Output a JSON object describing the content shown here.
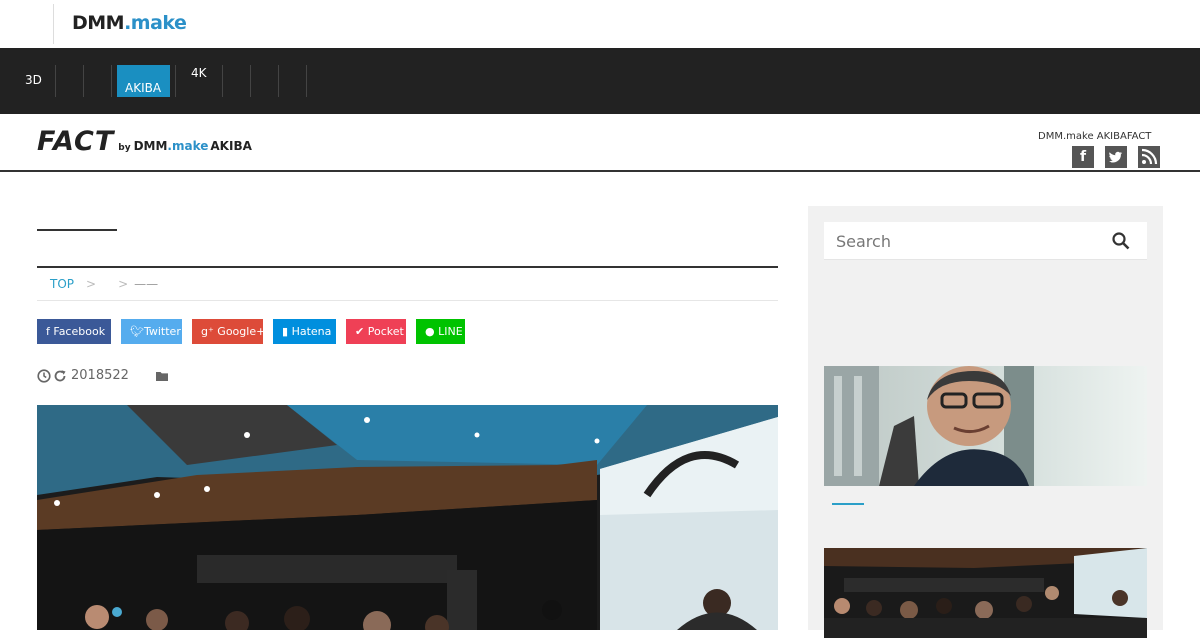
{
  "topbar": {
    "logo_dmm": "DMM",
    "logo_make": ".make"
  },
  "nav": {
    "items": [
      {
        "label": "3D"
      },
      {
        "label": "AKIBA",
        "active": true
      },
      {
        "label": "4K"
      }
    ]
  },
  "fact_header": {
    "logo_fact": "FACT",
    "logo_by": "by",
    "logo_dmm": "DMM",
    "logo_make": ".make",
    "logo_akiba": "AKIBA",
    "site_name": "DMM.make AKIBAFACT",
    "social": [
      "facebook-icon",
      "twitter-icon",
      "rss-icon"
    ]
  },
  "breadcrumb": {
    "top": "TOP",
    "sep": ">",
    "current": "——"
  },
  "share": {
    "facebook": "Facebook",
    "twitter": "Twitter",
    "googleplus": "Google+",
    "hatena": "Hatena",
    "pocket": "Pocket",
    "line": "LINE"
  },
  "meta": {
    "date": "2018522"
  },
  "sidebar": {
    "search_placeholder": "Search"
  },
  "colors": {
    "accent": "#2b9fc8",
    "nav_bg": "#222222",
    "nav_active": "#1a8fc1",
    "facebook": "#3b5998",
    "twitter": "#55acee",
    "googleplus": "#dd4b39",
    "hatena": "#008fde",
    "pocket": "#ef4056",
    "line": "#00c300"
  }
}
